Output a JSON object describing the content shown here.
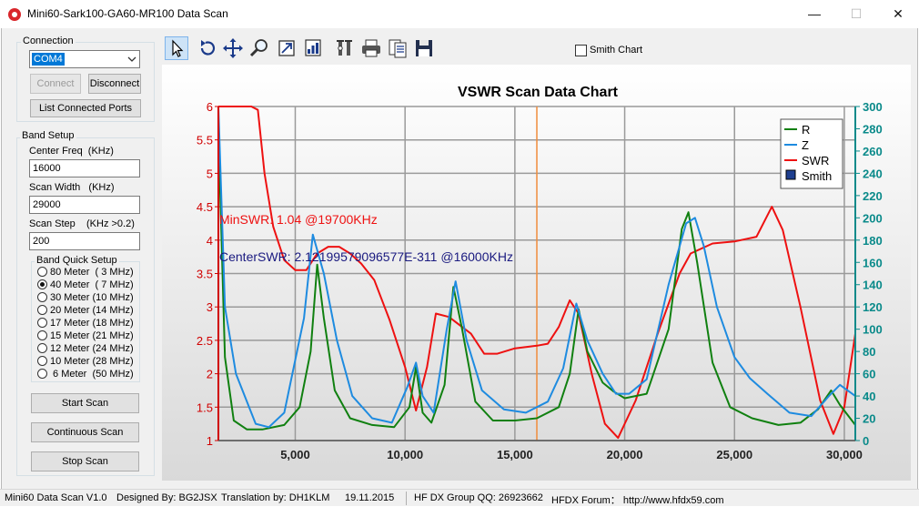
{
  "window": {
    "title": "Mini60-Sark100-GA60-MR100 Data Scan",
    "minimize": "—",
    "maximize": "☐",
    "close": "✕"
  },
  "connection": {
    "title": "Connection",
    "port_value": "COM4",
    "connect_label": "Connect",
    "disconnect_label": "Disconnect",
    "list_ports_label": "List Connected Ports"
  },
  "band_setup": {
    "title": "Band Setup",
    "center_freq_label": "Center Freq  (KHz)",
    "center_freq_value": "16000",
    "scan_width_label": "Scan Width   (KHz)",
    "scan_width_value": "29000",
    "scan_step_label": "Scan Step",
    "scan_step_hint": "(KHz >0.2)",
    "scan_step_value": "200",
    "quick_setup_title": "Band Quick Setup",
    "bands": [
      {
        "label": "80 Meter  ( 3 MHz)",
        "selected": false
      },
      {
        "label": "40 Meter  ( 7 MHz)",
        "selected": true
      },
      {
        "label": "30 Meter (10 MHz)",
        "selected": false
      },
      {
        "label": "20 Meter (14 MHz)",
        "selected": false
      },
      {
        "label": "17 Meter (18 MHz)",
        "selected": false
      },
      {
        "label": "15 Meter (21 MHz)",
        "selected": false
      },
      {
        "label": "12 Meter (24 MHz)",
        "selected": false
      },
      {
        "label": "10 Meter (28 MHz)",
        "selected": false
      },
      {
        "label": " 6 Meter  (50 MHz)",
        "selected": false
      }
    ],
    "start_scan_label": "Start Scan",
    "continuous_scan_label": "Continuous Scan",
    "stop_scan_label": "Stop Scan"
  },
  "toolbar": {
    "icons": [
      "pointer-icon",
      "undo-zoom-icon",
      "pan-icon",
      "zoom-icon",
      "zoom-fit-icon",
      "chart-image-icon",
      "properties-icon",
      "print-icon",
      "copy-data-icon",
      "save-icon"
    ],
    "smith_chart_label": "Smith Chart",
    "smith_chart_checked": false
  },
  "status_bar": {
    "version": "Mini60 Data Scan V1.0",
    "designed_by": "Designed By: BG2JSX",
    "translation": "Translation by: DH1KLM",
    "date": "19.11.2015",
    "group": "HF DX Group QQ: 26923662",
    "forum": "HFDX Forum： http://www.hfdx59.com"
  },
  "colors": {
    "r_series": "#108010",
    "z_series": "#1e8be0",
    "swr_series": "#ee1111",
    "center_marker": "#f08c3c",
    "title": "#1a1aaa",
    "left_axis": "#d00000",
    "right_axis": "#0a8a8a"
  },
  "chart_data": {
    "type": "line",
    "title": "VSWR Scan Data Chart",
    "x_ticks": [
      "5,000",
      "10,000",
      "15,000",
      "20,000",
      "25,000",
      "30,000"
    ],
    "x_tick_values": [
      5000,
      10000,
      15000,
      20000,
      25000,
      30000
    ],
    "xlim": [
      1500,
      30500
    ],
    "y_left_ticks": [
      "1",
      "1.5",
      "2",
      "2.5",
      "3",
      "3.5",
      "4",
      "4.5",
      "5",
      "5.5",
      "6"
    ],
    "y_left_tick_values": [
      1,
      1.5,
      2,
      2.5,
      3,
      3.5,
      4,
      4.5,
      5,
      5.5,
      6
    ],
    "ylim_left": [
      1,
      6
    ],
    "y_right_ticks": [
      "0",
      "20",
      "40",
      "60",
      "80",
      "100",
      "120",
      "140",
      "160",
      "180",
      "200",
      "220",
      "240",
      "260",
      "280",
      "300"
    ],
    "y_right_tick_values": [
      0,
      20,
      40,
      60,
      80,
      100,
      120,
      140,
      160,
      180,
      200,
      220,
      240,
      260,
      280,
      300
    ],
    "ylim_right": [
      0,
      300
    ],
    "grid": true,
    "legend_position": "top-right",
    "legend": [
      "R",
      "Z",
      "SWR",
      "Smith"
    ],
    "center_marker_x": 16000,
    "annotations": {
      "min_swr": "MinSWR: 1.04 @19700KHz",
      "center_swr": "CenterSWR: 2.12199579096577E-311 @16000KHz"
    },
    "series": [
      {
        "name": "SWR",
        "axis": "left",
        "points": [
          [
            1500,
            6
          ],
          [
            2000,
            6
          ],
          [
            3000,
            6
          ],
          [
            3300,
            5.95
          ],
          [
            3600,
            5.0
          ],
          [
            4000,
            4.2
          ],
          [
            4500,
            3.7
          ],
          [
            5000,
            3.55
          ],
          [
            5500,
            3.55
          ],
          [
            6000,
            3.8
          ],
          [
            6500,
            3.9
          ],
          [
            7000,
            3.9
          ],
          [
            7500,
            3.8
          ],
          [
            8000,
            3.65
          ],
          [
            8600,
            3.4
          ],
          [
            9300,
            2.8
          ],
          [
            10000,
            2.1
          ],
          [
            10500,
            1.45
          ],
          [
            11000,
            2.1
          ],
          [
            11400,
            2.9
          ],
          [
            12000,
            2.85
          ],
          [
            13000,
            2.6
          ],
          [
            13600,
            2.3
          ],
          [
            14200,
            2.3
          ],
          [
            15000,
            2.38
          ],
          [
            16000,
            2.42
          ],
          [
            16500,
            2.45
          ],
          [
            17000,
            2.7
          ],
          [
            17500,
            3.1
          ],
          [
            17900,
            2.9
          ],
          [
            18500,
            2.0
          ],
          [
            19100,
            1.25
          ],
          [
            19700,
            1.04
          ],
          [
            20500,
            1.6
          ],
          [
            21500,
            2.6
          ],
          [
            22500,
            3.5
          ],
          [
            23000,
            3.8
          ],
          [
            24000,
            3.95
          ],
          [
            25000,
            3.98
          ],
          [
            26000,
            4.05
          ],
          [
            26700,
            4.5
          ],
          [
            27200,
            4.15
          ],
          [
            28000,
            3.0
          ],
          [
            28900,
            1.6
          ],
          [
            29500,
            1.1
          ],
          [
            30000,
            1.5
          ],
          [
            30500,
            2.6
          ]
        ]
      },
      {
        "name": "R",
        "axis": "right",
        "points": [
          [
            1500,
            280
          ],
          [
            1800,
            75
          ],
          [
            2200,
            18
          ],
          [
            2800,
            10
          ],
          [
            3500,
            10
          ],
          [
            4500,
            14
          ],
          [
            5200,
            30
          ],
          [
            5700,
            80
          ],
          [
            6000,
            158
          ],
          [
            6300,
            110
          ],
          [
            6800,
            45
          ],
          [
            7500,
            20
          ],
          [
            8500,
            14
          ],
          [
            9500,
            12
          ],
          [
            10200,
            30
          ],
          [
            10500,
            66
          ],
          [
            10800,
            25
          ],
          [
            11200,
            16
          ],
          [
            11800,
            50
          ],
          [
            12200,
            138
          ],
          [
            12600,
            100
          ],
          [
            13200,
            35
          ],
          [
            14000,
            18
          ],
          [
            15000,
            18
          ],
          [
            16000,
            20
          ],
          [
            17000,
            30
          ],
          [
            17500,
            60
          ],
          [
            17900,
            118
          ],
          [
            18300,
            80
          ],
          [
            19000,
            52
          ],
          [
            19500,
            44
          ],
          [
            20000,
            38
          ],
          [
            21000,
            42
          ],
          [
            22000,
            100
          ],
          [
            22600,
            190
          ],
          [
            22900,
            205
          ],
          [
            23300,
            160
          ],
          [
            24000,
            70
          ],
          [
            24800,
            30
          ],
          [
            25800,
            20
          ],
          [
            27000,
            14
          ],
          [
            28000,
            16
          ],
          [
            28800,
            28
          ],
          [
            29400,
            45
          ],
          [
            29800,
            32
          ],
          [
            30500,
            14
          ]
        ]
      },
      {
        "name": "Z",
        "axis": "right",
        "points": [
          [
            1500,
            300
          ],
          [
            1800,
            120
          ],
          [
            2300,
            60
          ],
          [
            3200,
            15
          ],
          [
            3800,
            12
          ],
          [
            4500,
            25
          ],
          [
            5400,
            110
          ],
          [
            5800,
            185
          ],
          [
            6300,
            150
          ],
          [
            6900,
            90
          ],
          [
            7600,
            40
          ],
          [
            8500,
            20
          ],
          [
            9400,
            16
          ],
          [
            10100,
            48
          ],
          [
            10500,
            70
          ],
          [
            10800,
            40
          ],
          [
            11300,
            25
          ],
          [
            11900,
            100
          ],
          [
            12300,
            143
          ],
          [
            12800,
            90
          ],
          [
            13500,
            45
          ],
          [
            14500,
            28
          ],
          [
            15500,
            25
          ],
          [
            16500,
            35
          ],
          [
            17200,
            65
          ],
          [
            17800,
            123
          ],
          [
            18300,
            90
          ],
          [
            19000,
            60
          ],
          [
            19600,
            42
          ],
          [
            20200,
            42
          ],
          [
            21000,
            55
          ],
          [
            22000,
            140
          ],
          [
            22800,
            195
          ],
          [
            23200,
            200
          ],
          [
            23600,
            175
          ],
          [
            24200,
            120
          ],
          [
            25000,
            75
          ],
          [
            25700,
            56
          ],
          [
            26500,
            42
          ],
          [
            27500,
            25
          ],
          [
            28500,
            22
          ],
          [
            29300,
            40
          ],
          [
            29800,
            50
          ],
          [
            30500,
            40
          ]
        ]
      }
    ]
  }
}
